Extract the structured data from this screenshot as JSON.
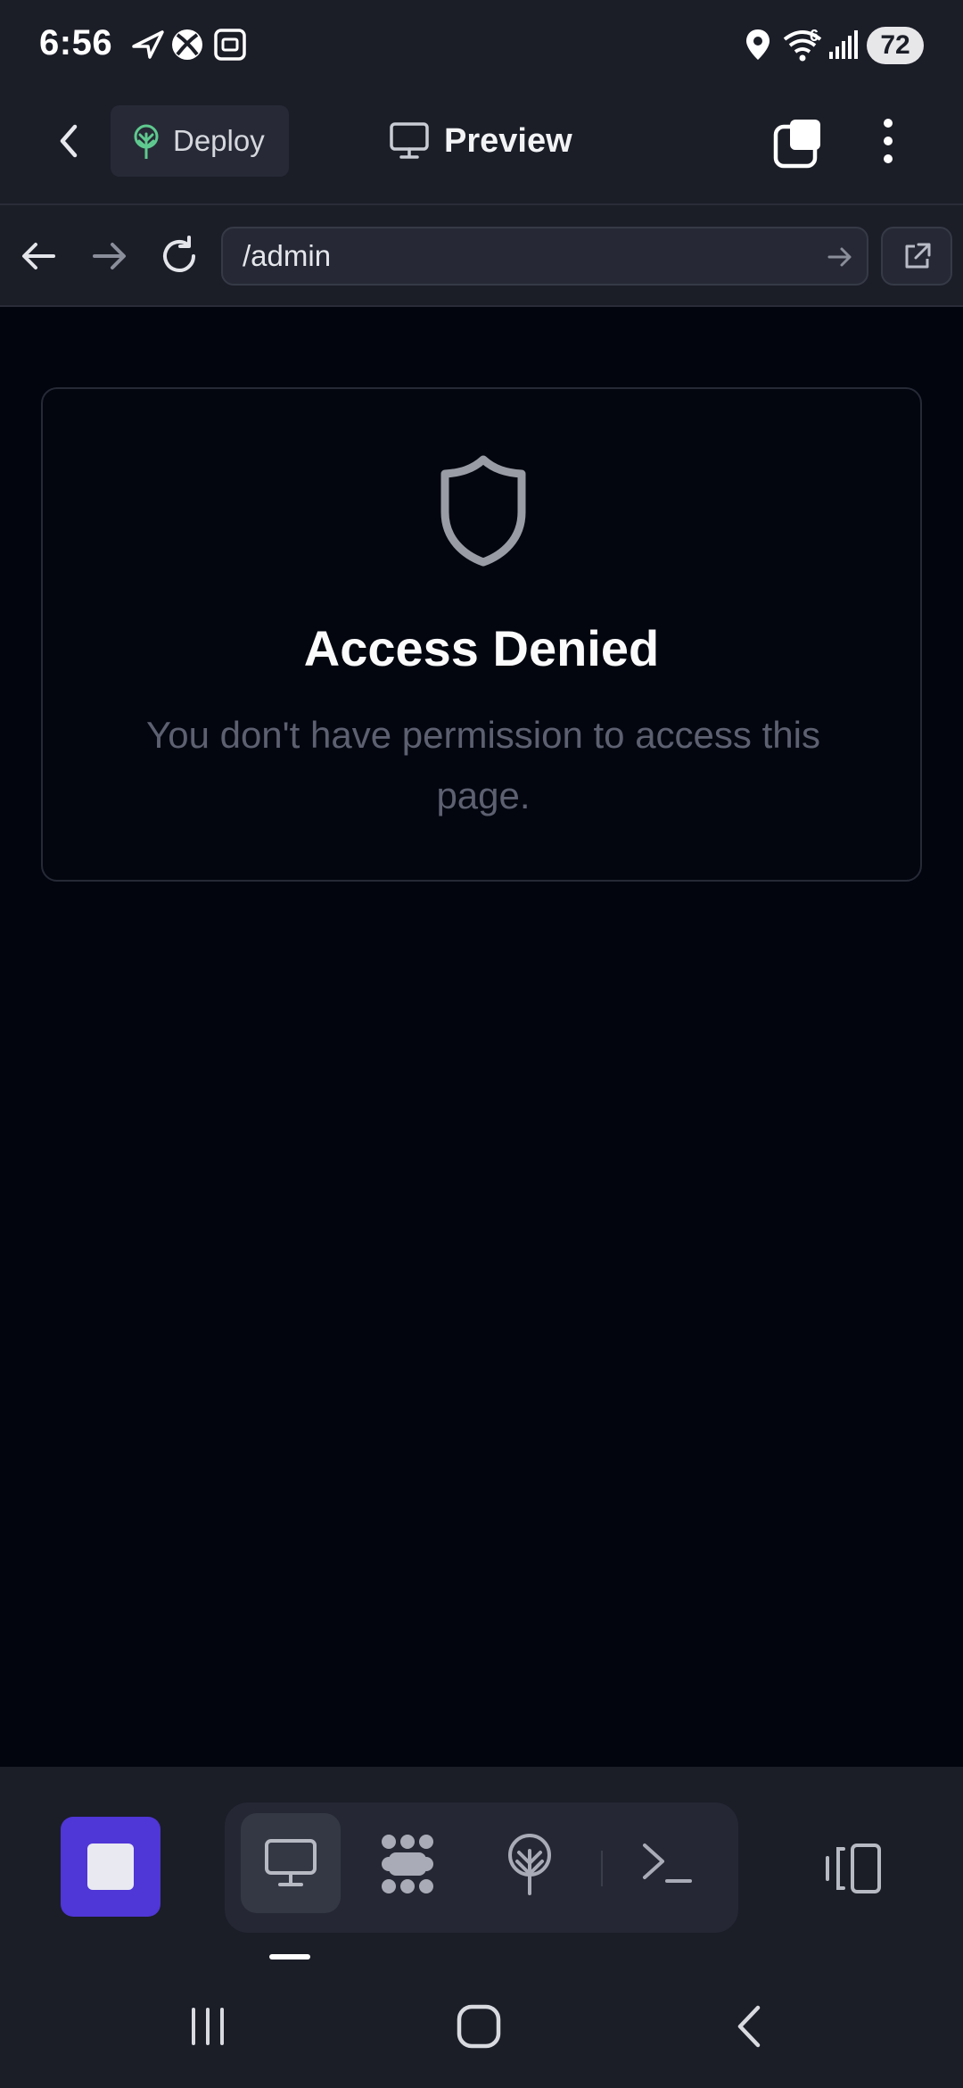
{
  "status_bar": {
    "time": "6:56",
    "battery": "72",
    "icons": [
      "navigation-arrow-icon",
      "xbox-icon",
      "screenshot-icon",
      "location-icon",
      "wifi-icon",
      "signal-icon"
    ],
    "wifi_badge": "6"
  },
  "toolbar": {
    "back_icon": "chevron-left-icon",
    "deploy_label": "Deploy",
    "deploy_icon": "deploy-tree-icon",
    "title": "Preview",
    "title_icon": "monitor-icon",
    "tabs_icon": "tabs-icon",
    "menu_icon": "more-vertical-icon"
  },
  "browser": {
    "url": "/admin",
    "controls": [
      "back-arrow-icon",
      "forward-arrow-icon",
      "reload-icon"
    ],
    "go_icon": "arrow-right-icon",
    "open_external_icon": "external-link-icon"
  },
  "content": {
    "icon": "shield-icon",
    "title": "Access Denied",
    "message": "You don't have permission to access this page."
  },
  "dock": {
    "stop_icon": "stop-icon",
    "modes": [
      "monitor-icon",
      "dots-grid-icon",
      "deploy-tree-icon",
      "terminal-icon"
    ],
    "active_mode": "monitor-icon",
    "layout_icon": "split-panel-icon"
  },
  "nav_bar": {
    "buttons": [
      "recents-icon",
      "home-icon",
      "back-icon"
    ]
  },
  "colors": {
    "background": "#02050e",
    "bar": "#1b1d27",
    "accent": "#4f36d6",
    "deploy_green": "#5fc98f",
    "muted_text": "#5c6070"
  }
}
